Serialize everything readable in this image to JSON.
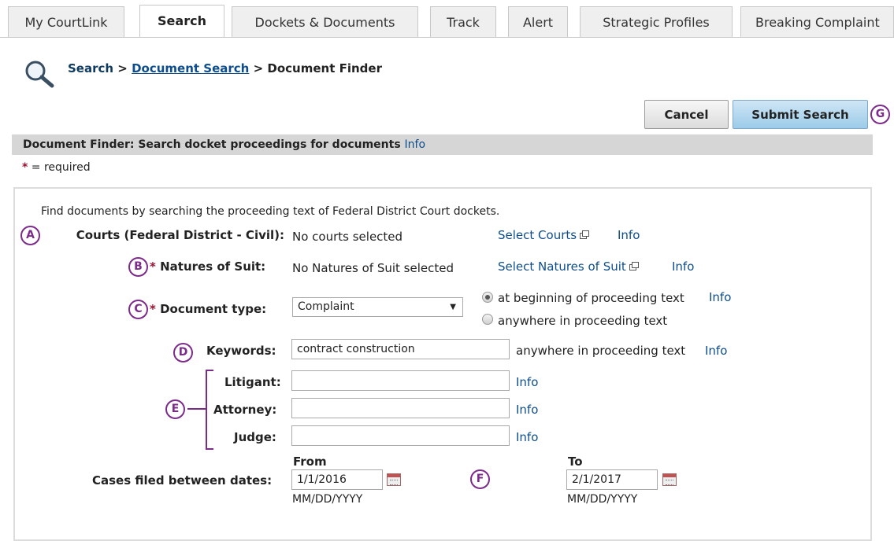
{
  "tabs": [
    "My CourtLink",
    "Search",
    "Dockets & Documents",
    "Track",
    "Alert",
    "Strategic Profiles",
    "Breaking Complaint"
  ],
  "breadcrumb": {
    "root": "Search",
    "sep1": " > ",
    "middle": "Document Search",
    "sep2": " > ",
    "current": "Document Finder"
  },
  "buttons": {
    "cancel": "Cancel",
    "submit": "Submit Search"
  },
  "banner": {
    "title": "Document Finder: Search docket proceedings for documents",
    "info": "Info"
  },
  "required_note": {
    "star": "*",
    "text": " = required"
  },
  "intro": "Find documents by searching the proceeding text of Federal District Court dockets.",
  "courts": {
    "label": "Courts (Federal District - Civil):",
    "value": "No courts selected",
    "link": "Select Courts",
    "info": "Info"
  },
  "natures": {
    "star": "*",
    "label": "Natures of Suit:",
    "value": "No Natures of Suit selected",
    "link": "Select Natures of Suit",
    "info": "Info"
  },
  "doctype": {
    "star": "*",
    "label": "Document type:",
    "selected": "Complaint",
    "arrow": "▼",
    "option1": "at beginning of proceeding text",
    "option2": "anywhere in proceeding text",
    "info": "Info"
  },
  "keywords": {
    "label": "Keywords:",
    "value": "contract construction",
    "scope": "anywhere in proceeding text",
    "info": "Info"
  },
  "litigant": {
    "label": "Litigant:",
    "value": "",
    "info": "Info"
  },
  "attorney": {
    "label": "Attorney:",
    "value": "",
    "info": "Info"
  },
  "judge": {
    "label": "Judge:",
    "value": "",
    "info": "Info"
  },
  "dates": {
    "label": "Cases filed between dates:",
    "from_label": "From",
    "from_value": "1/1/2016",
    "from_format": "MM/DD/YYYY",
    "to_label": "To",
    "to_value": "2/1/2017",
    "to_format": "MM/DD/YYYY"
  },
  "markers": [
    "A",
    "B",
    "C",
    "D",
    "E",
    "F",
    "G"
  ],
  "colors": {
    "marker": "#7d2b8b",
    "link": "#0e4d8c",
    "required": "#a01030",
    "banner": "#d6d6d6",
    "submit": "#9ccbe9"
  }
}
